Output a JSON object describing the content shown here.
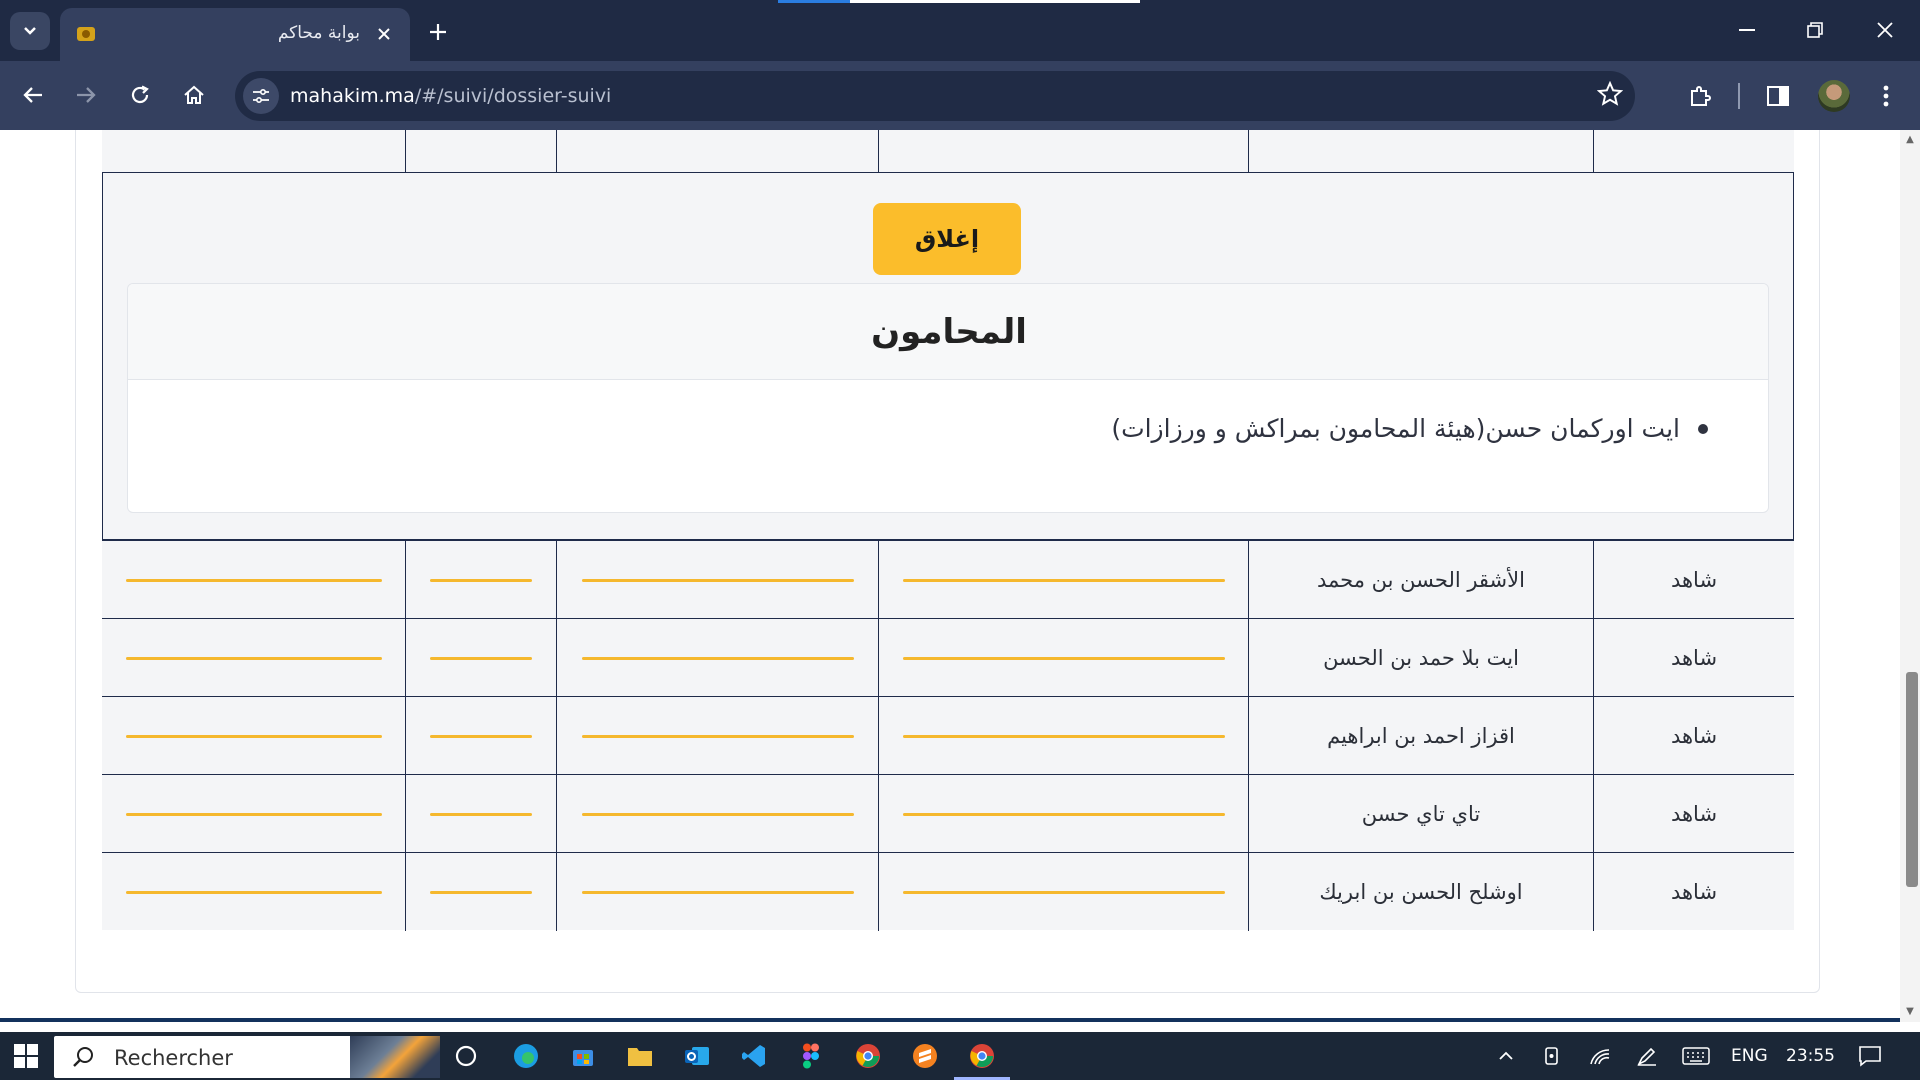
{
  "browser": {
    "tab_title": "بوابة محاكم",
    "url_host": "mahakim.ma",
    "url_path": "/#/suivi/dossier-suivi"
  },
  "page": {
    "close_button": "إغلاق",
    "lawyers_title": "المحامون",
    "lawyers": [
      "ايت اوركمان حسن(هيئة المحامون بمراكش و ورزازات)"
    ],
    "rows": [
      {
        "role": "شاهد",
        "name": "الأشقر الحسن بن محمد"
      },
      {
        "role": "شاهد",
        "name": "ايت بلا حمد بن الحسن"
      },
      {
        "role": "شاهد",
        "name": "اقزاز احمد بن ابراهيم"
      },
      {
        "role": "شاهد",
        "name": "تاي تاي حسن"
      },
      {
        "role": "شاهد",
        "name": "اوشلح الحسن بن ابريك"
      }
    ]
  },
  "taskbar": {
    "search_placeholder": "Rechercher",
    "language": "ENG",
    "time": "23:55"
  },
  "colors": {
    "accent_yellow": "#fbbd2b",
    "navy": "#13315c",
    "table_border": "#1f2b4a"
  }
}
